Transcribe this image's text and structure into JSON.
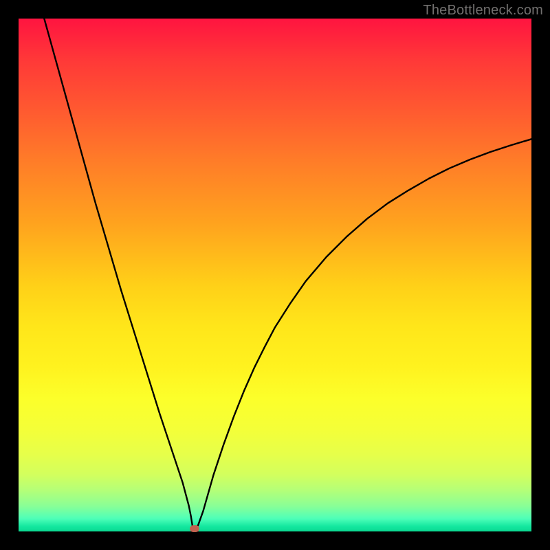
{
  "watermark": "TheBottleneck.com",
  "colors": {
    "frame": "#000000",
    "curve": "#000000",
    "dot": "#c0614f",
    "watermark": "#72706f"
  },
  "chart_data": {
    "type": "line",
    "title": "",
    "xlabel": "",
    "ylabel": "",
    "xlim": [
      0,
      100
    ],
    "ylim": [
      0,
      100
    ],
    "grid": false,
    "legend": false,
    "x": [
      5.0,
      7.5,
      10.0,
      12.5,
      15.0,
      17.5,
      20.0,
      22.5,
      25.0,
      27.5,
      30.0,
      31.0,
      32.0,
      32.8,
      33.2,
      33.6,
      34.0,
      34.5,
      35.0,
      36.0,
      37.0,
      38.0,
      40.0,
      42.0,
      44.0,
      46.0,
      48.0,
      50.0,
      53.0,
      56.0,
      60.0,
      64.0,
      68.0,
      72.0,
      76.0,
      80.0,
      84.0,
      88.0,
      92.0,
      96.0,
      100.0
    ],
    "values": [
      100.0,
      91.0,
      82.0,
      73.0,
      64.0,
      55.5,
      47.0,
      39.0,
      31.0,
      23.0,
      15.5,
      12.5,
      9.5,
      6.5,
      5.0,
      3.0,
      0.5,
      0.5,
      1.2,
      4.0,
      7.5,
      11.0,
      17.0,
      22.5,
      27.5,
      32.0,
      36.0,
      39.8,
      44.5,
      48.8,
      53.5,
      57.5,
      61.0,
      64.0,
      66.5,
      68.8,
      70.8,
      72.5,
      74.0,
      75.3,
      76.5
    ],
    "marker": {
      "x": 34.3,
      "y": 0.5
    }
  }
}
